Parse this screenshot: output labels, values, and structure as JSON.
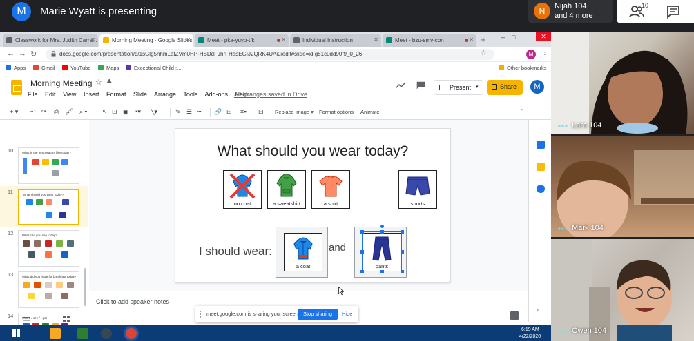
{
  "meet": {
    "presenter_initial": "M",
    "presenter_text": "Marie Wyatt is presenting",
    "chip_initial": "N",
    "chip_line1": "Nijah 104",
    "chip_line2": "and 4 more",
    "people_count": "10"
  },
  "browser": {
    "tabs": [
      {
        "label": "Classwork for Mrs. Judith Carra...",
        "color": "#5f6368"
      },
      {
        "label": "Morning Meeting - Google Slides",
        "color": "#f4b400"
      },
      {
        "label": "Meet - pka-yuyo-tfk",
        "color": "#00897b"
      },
      {
        "label": "Individual Instruction",
        "color": "#5f6368"
      },
      {
        "label": "Meet - bzu-smv-cbn",
        "color": "#00897b"
      }
    ],
    "url": "docs.google.com/presentation/d/1sGlg5nhmLatZVm0HP-HSDdFJhrFHasEGIJ2QRK4UAi0/edit#slide=id.g81c0dd90f9_0_26",
    "profile_initial": "M",
    "bookmarks": [
      "Apps",
      "Gmail",
      "YouTube",
      "Maps",
      "Exceptional Child :...",
      "Other bookmarks"
    ]
  },
  "slides_app": {
    "title": "Morning Meeting",
    "menus": [
      "File",
      "Edit",
      "View",
      "Insert",
      "Format",
      "Slide",
      "Arrange",
      "Tools",
      "Add-ons",
      "Help"
    ],
    "saved_status": "All changes saved in Drive",
    "present_label": "Present",
    "share_label": "Share",
    "user_initial": "M",
    "toolbar": {
      "replace_image": "Replace image ▾",
      "format_options": "Format options",
      "animate": "Animate"
    },
    "thumbnails": [
      {
        "number": "10",
        "title": "What is the temperature like today?"
      },
      {
        "number": "11",
        "title": "What should you wear today?"
      },
      {
        "number": "12",
        "title": "What can you see today?"
      },
      {
        "number": "13",
        "title": "What did you have for breakfast today?"
      },
      {
        "number": "14",
        "title": "I have / see / I got"
      }
    ],
    "speaker_notes_placeholder": "Click to add speaker notes"
  },
  "slide": {
    "title": "What should you wear today?",
    "choices": [
      {
        "label": "no coat"
      },
      {
        "label": "a sweatshirt"
      },
      {
        "label": "a shirt"
      },
      {
        "label": "shorts"
      }
    ],
    "sentence_start": "I should wear:",
    "connector": "and",
    "answers": [
      {
        "label": "a coat"
      },
      {
        "label": "pants"
      }
    ]
  },
  "share_bar": {
    "message": "meet.google.com is sharing your screen.",
    "stop_label": "Stop sharing",
    "hide_label": "Hide"
  },
  "taskbar": {
    "time": "6:19 AM",
    "date": "4/22/2020"
  },
  "participants": [
    {
      "name": "Lara 104"
    },
    {
      "name": "Mark 104"
    },
    {
      "name": "Owen 104"
    }
  ],
  "colors": {
    "meet_bg": "#202124",
    "slides_yellow": "#f4b400",
    "google_blue": "#1a73e8",
    "selection_blue": "#1a73e8"
  }
}
